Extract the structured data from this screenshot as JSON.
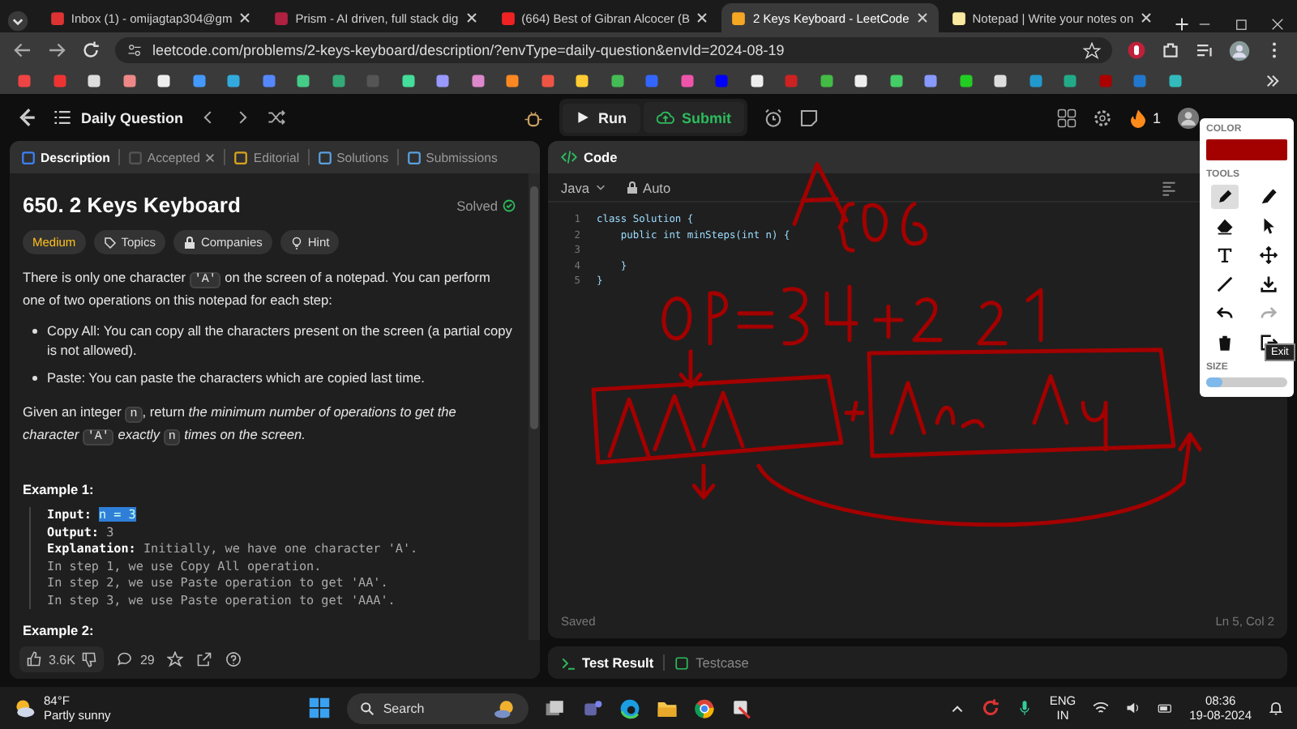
{
  "browser": {
    "tabs": [
      {
        "title": "Inbox (1) - omijagtap304@gm",
        "selected": false
      },
      {
        "title": "Prism - AI driven, full stack dig",
        "selected": false
      },
      {
        "title": "(664) Best of Gibran Alcocer (B",
        "selected": false
      },
      {
        "title": "2 Keys Keyboard - LeetCode",
        "selected": true
      },
      {
        "title": "Notepad | Write your notes on",
        "selected": false
      }
    ],
    "url": "leetcode.com/problems/2-keys-keyboard/description/?envType=daily-question&envId=2024-08-19"
  },
  "topbar": {
    "title": "Daily Question",
    "run": "Run",
    "submit": "Submit",
    "streak": "1"
  },
  "description": {
    "tabs": [
      {
        "label": "Description",
        "selected": true,
        "closable": false
      },
      {
        "label": "Accepted",
        "selected": false,
        "closable": true
      },
      {
        "label": "Editorial",
        "selected": false,
        "closable": false
      },
      {
        "label": "Solutions",
        "selected": false,
        "closable": false
      },
      {
        "label": "Submissions",
        "selected": false,
        "closable": false
      }
    ],
    "title": "650. 2 Keys Keyboard",
    "status": "Solved",
    "tags": [
      {
        "kind": "difficulty",
        "label": "Medium"
      },
      {
        "kind": "topics",
        "label": "Topics"
      },
      {
        "kind": "companies",
        "label": "Companies"
      },
      {
        "kind": "hint",
        "label": "Hint"
      }
    ],
    "intro": [
      {
        "kind": "plain",
        "text": "There is only one character "
      },
      {
        "kind": "code",
        "text": "'A'"
      },
      {
        "kind": "plain",
        "text": " on the screen of a notepad. You can perform one of two operations on this notepad for each step:"
      }
    ],
    "bullets": [
      "Copy All: You can copy all the characters present on the screen (a partial copy is not allowed).",
      "Paste: You can paste the characters which are copied last time."
    ],
    "task": [
      {
        "kind": "plain",
        "text": "Given an integer "
      },
      {
        "kind": "code",
        "text": "n"
      },
      {
        "kind": "plain",
        "text": ", return "
      },
      {
        "kind": "italic",
        "text": "the minimum number of operations to get the character "
      },
      {
        "kind": "code",
        "text": "'A'"
      },
      {
        "kind": "italic",
        "text": " exactly "
      },
      {
        "kind": "code",
        "text": "n"
      },
      {
        "kind": "italic",
        "text": " times on the screen."
      }
    ],
    "example_title": "Example 1:",
    "example_lines": [
      {
        "label": "Input:",
        "value": "n = 3",
        "highlighted": true
      },
      {
        "label": "Output:",
        "value": "3",
        "highlighted": false
      },
      {
        "label": "Explanation:",
        "value": "Initially, we have one character 'A'.",
        "highlighted": false
      },
      {
        "value": "In step 1, we use Copy All operation.",
        "highlighted": false
      },
      {
        "value": "In step 2, we use Paste operation to get 'AA'.",
        "highlighted": false
      },
      {
        "value": "In step 3, we use Paste operation to get 'AAA'.",
        "highlighted": false
      }
    ],
    "next_example": "Example 2:",
    "likes": "3.6K",
    "comments": "29"
  },
  "code": {
    "header": "Code",
    "language": "Java",
    "mode": "Auto",
    "lines": [
      {
        "number": "1",
        "text": "class Solution {"
      },
      {
        "number": "2",
        "text": "    public int minSteps(int n) {"
      },
      {
        "number": "3"
      },
      {
        "number": "4",
        "text": "    }"
      },
      {
        "number": "5",
        "text": "}"
      }
    ],
    "status": "Saved",
    "cursor": "Ln 5, Col 2",
    "bottom_tabs": [
      {
        "label": "Test Result",
        "selected": true
      },
      {
        "label": "Testcase",
        "selected": false
      }
    ]
  },
  "draw_tools": {
    "color_label": "COLOR",
    "tools_label": "TOOLS",
    "tools": [
      {
        "kind": "pencil",
        "selected": true,
        "disabled": false
      },
      {
        "kind": "marker",
        "selected": false,
        "disabled": false
      },
      {
        "kind": "eraser",
        "selected": false,
        "disabled": false
      },
      {
        "kind": "pointer",
        "selected": false,
        "disabled": false
      },
      {
        "kind": "text",
        "selected": false,
        "disabled": false
      },
      {
        "kind": "move",
        "selected": false,
        "disabled": false
      },
      {
        "kind": "line",
        "selected": false,
        "disabled": false
      },
      {
        "kind": "download",
        "selected": false,
        "disabled": false
      },
      {
        "kind": "undo",
        "selected": false,
        "disabled": false
      },
      {
        "kind": "redo",
        "selected": false,
        "disabled": true
      },
      {
        "kind": "trash",
        "selected": false,
        "disabled": false
      },
      {
        "kind": "exit",
        "selected": false,
        "disabled": false
      }
    ],
    "size_label": "SIZE",
    "size": {
      "level": 0.2
    },
    "tooltip": "Exit"
  },
  "taskbar": {
    "weather": {
      "temp": "84°F",
      "condition": "Partly sunny"
    },
    "search": "Search",
    "language": {
      "line1": "ENG",
      "line2": "IN"
    },
    "time": "08:36",
    "date": "19-08-2024"
  }
}
